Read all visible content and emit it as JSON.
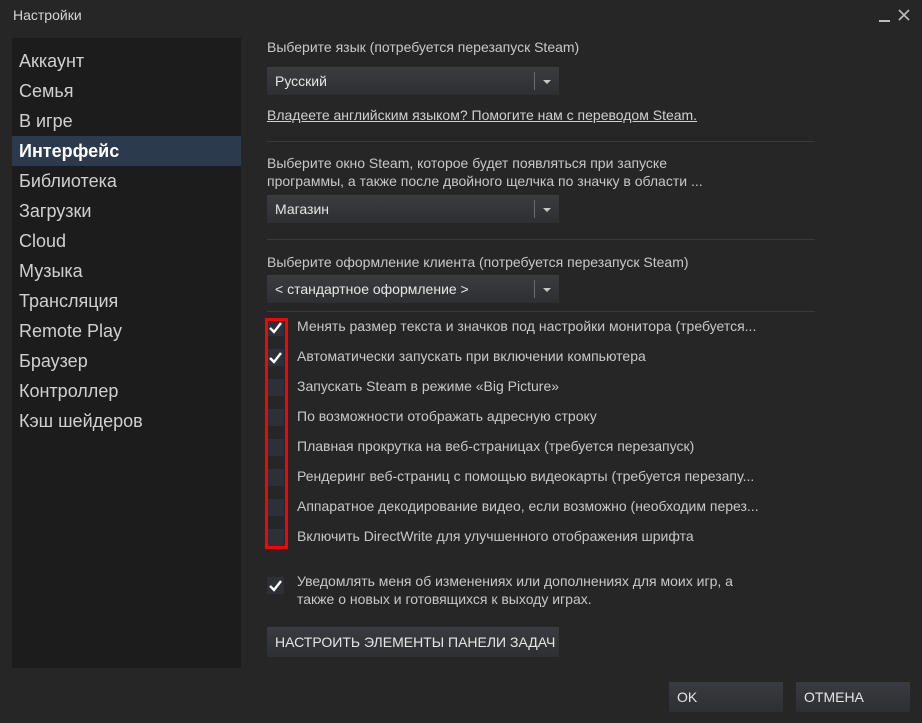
{
  "window": {
    "title": "Настройки"
  },
  "sidebar": {
    "items": [
      {
        "label": "Аккаунт",
        "active": false
      },
      {
        "label": "Семья",
        "active": false
      },
      {
        "label": "В игре",
        "active": false
      },
      {
        "label": "Интерфейс",
        "active": true
      },
      {
        "label": "Библиотека",
        "active": false
      },
      {
        "label": "Загрузки",
        "active": false
      },
      {
        "label": "Cloud",
        "active": false
      },
      {
        "label": "Музыка",
        "active": false
      },
      {
        "label": "Трансляция",
        "active": false
      },
      {
        "label": "Remote Play",
        "active": false
      },
      {
        "label": "Браузер",
        "active": false
      },
      {
        "label": "Контроллер",
        "active": false
      },
      {
        "label": "Кэш шейдеров",
        "active": false
      }
    ]
  },
  "main": {
    "language": {
      "label": "Выберите язык (потребуется перезапуск Steam)",
      "value": "Русский",
      "link": "Владеете английским языком? Помогите нам с переводом Steam."
    },
    "startup_window": {
      "label_line1": "Выберите окно Steam, которое будет появляться при запуске",
      "label_line2": "программы, а также после двойного щелчка по значку в области ...",
      "value": "Магазин"
    },
    "skin": {
      "label": "Выберите оформление клиента (потребуется перезапуск Steam)",
      "value": "< стандартное оформление >"
    },
    "checkboxes": [
      {
        "label": "Менять размер текста и значков под настройки монитора (требуется...",
        "checked": true
      },
      {
        "label": "Автоматически запускать при включении компьютера",
        "checked": true
      },
      {
        "label": "Запускать Steam в режиме «Big Picture»",
        "checked": false
      },
      {
        "label": "По возможности отображать адресную строку",
        "checked": false
      },
      {
        "label": "Плавная прокрутка на веб-страницах (требуется перезапуск)",
        "checked": false
      },
      {
        "label": "Рендеринг веб-страниц с помощью видеокарты (требуется перезапу...",
        "checked": false
      },
      {
        "label": "Аппаратное декодирование видео, если возможно (необходим перез...",
        "checked": false
      },
      {
        "label": "Включить DirectWrite для улучшенного отображения шрифта",
        "checked": false
      }
    ],
    "notify": {
      "label_line1": "Уведомлять меня об изменениях или дополнениях для моих игр, а",
      "label_line2": "также о новых и готовящихся к выходу играх.",
      "checked": true
    },
    "taskbar_button": "НАСТРОИТЬ ЭЛЕМЕНТЫ ПАНЕЛИ ЗАДАЧ"
  },
  "footer": {
    "ok_label": "OK",
    "cancel_label": "ОТМЕНА"
  },
  "icons": {
    "check": "checkmark-icon",
    "close": "close-icon",
    "minimize": "minimize-icon",
    "dropdown": "chevron-down-icon"
  },
  "colors": {
    "accent_active": "#2b3a4c",
    "highlight_border": "#ff0000",
    "window_bg": "#262626",
    "sidebar_bg": "#1c1c1c"
  }
}
